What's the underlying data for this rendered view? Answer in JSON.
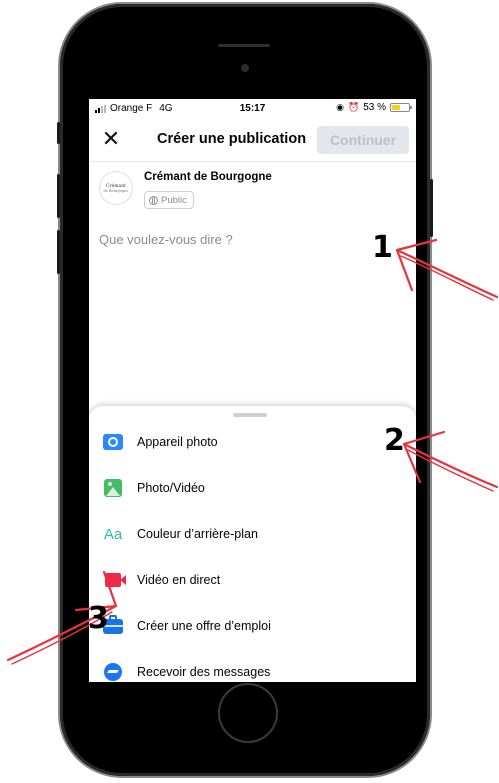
{
  "status_bar": {
    "carrier": "Orange F",
    "network": "4G",
    "time": "15:17",
    "battery": "53 %",
    "battery_level": 0.53
  },
  "header": {
    "close_icon": "close-icon",
    "title": "Créer une publication",
    "continue_label": "Continuer"
  },
  "page": {
    "avatar_line1": "Crémant",
    "avatar_line2": "de Bourgogne",
    "name": "Crémant de Bourgogne",
    "audience": "Public",
    "audience_icon": "globe-icon"
  },
  "composer": {
    "placeholder": "Que voulez-vous dire ?"
  },
  "options": [
    {
      "label": "Appareil photo",
      "icon": "camera-icon",
      "color": "#2d88ff"
    },
    {
      "label": "Photo/Vidéo",
      "icon": "photo-icon",
      "color": "#45bd62"
    },
    {
      "label": "Couleur d’arrière-plan",
      "icon": "text-color-icon",
      "color": "#2abba7",
      "glyph": "Aa"
    },
    {
      "label": "Vidéo en direct",
      "icon": "live-video-icon",
      "color": "#f02849"
    },
    {
      "label": "Créer une offre d’emploi",
      "icon": "briefcase-icon",
      "color": "#1b74e4"
    },
    {
      "label": "Recevoir des messages",
      "icon": "messenger-icon",
      "color": "#1877f2"
    }
  ],
  "annotations": {
    "labels": [
      "1",
      "2",
      "3"
    ],
    "arrow_color": "#e8323c"
  }
}
